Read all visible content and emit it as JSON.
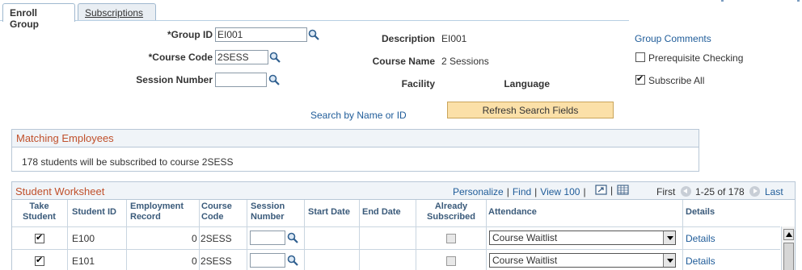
{
  "tabs": {
    "enroll_group": "Enroll Group",
    "subscriptions": "Subscriptions"
  },
  "form": {
    "group_id_label": "*Group ID",
    "group_id_value": "EI001",
    "course_code_label": "*Course Code",
    "course_code_value": "2SESS",
    "session_number_label": "Session Number",
    "session_number_value": "",
    "description_label": "Description",
    "description_value": "EI001",
    "course_name_label": "Course Name",
    "course_name_value": "2 Sessions",
    "facility_label": "Facility",
    "language_label": "Language",
    "group_comments_link": "Group Comments",
    "prereq_label": "Prerequisite Checking",
    "prereq_checked": false,
    "subscribe_all_label": "Subscribe All",
    "subscribe_all_checked": true,
    "search_link": "Search by Name or ID",
    "refresh_button": "Refresh Search Fields"
  },
  "matching": {
    "title": "Matching Employees",
    "message": "178 students will be subscribed to course 2SESS"
  },
  "worksheet": {
    "title": "Student Worksheet",
    "personalize": "Personalize",
    "find": "Find",
    "view100": "View 100",
    "first": "First",
    "range": "1-25 of 178",
    "last": "Last",
    "columns": {
      "take_student": "Take Student",
      "student_id": "Student ID",
      "employment_record": "Employment Record",
      "course_code": "Course Code",
      "session_number": "Session Number",
      "start_date": "Start Date",
      "end_date": "End Date",
      "already_subscribed": "Already Subscribed",
      "attendance": "Attendance",
      "details": "Details"
    },
    "rows": [
      {
        "take": true,
        "student_id": "E100",
        "employment_record": "0",
        "course_code": "2SESS",
        "session_number": "",
        "attendance": "Course Waitlist",
        "details": "Details"
      },
      {
        "take": true,
        "student_id": "E101",
        "employment_record": "0",
        "course_code": "2SESS",
        "session_number": "",
        "attendance": "Course Waitlist",
        "details": "Details"
      }
    ]
  }
}
